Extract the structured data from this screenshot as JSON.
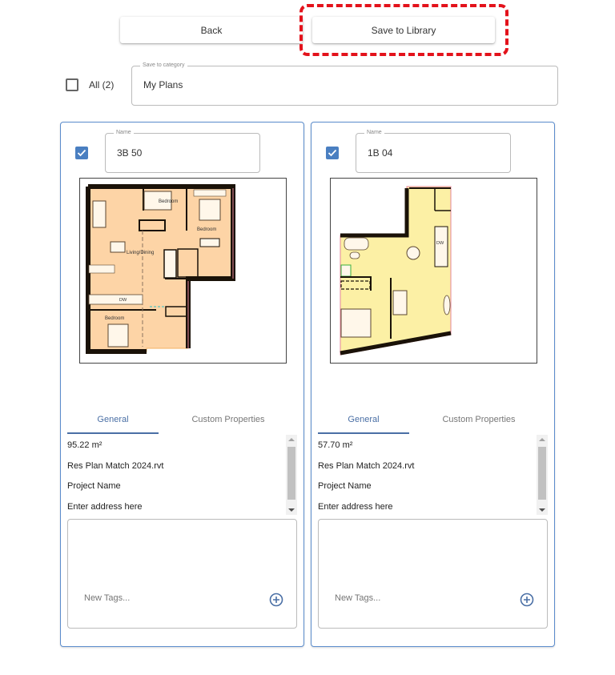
{
  "toolbar": {
    "back_label": "Back",
    "save_label": "Save to Library",
    "highlight_color": "#e3121b"
  },
  "selection": {
    "all_label": "All (2)",
    "all_checked": false
  },
  "category": {
    "legend": "Save to category",
    "value": "My Plans"
  },
  "tabs": {
    "general": "General",
    "custom": "Custom Properties"
  },
  "accent_color": "#4a6fa5",
  "cards": [
    {
      "checked": true,
      "name_legend": "Name",
      "name": "3B 50",
      "plan_fill": "#fdd4a6",
      "plan_labels": [
        "Bedroom",
        "Bedroom",
        "Living/Dining",
        "Bedroom",
        "DW"
      ],
      "properties": [
        "95.22 m²",
        "Res Plan Match 2024.rvt",
        "Project Name",
        "Enter address here"
      ],
      "tags_placeholder": "New Tags..."
    },
    {
      "checked": true,
      "name_legend": "Name",
      "name": "1B 04",
      "plan_fill": "#fcf0a5",
      "plan_labels": [
        "DW"
      ],
      "properties": [
        "57.70 m²",
        "Res Plan Match 2024.rvt",
        "Project Name",
        "Enter address here"
      ],
      "tags_placeholder": "New Tags..."
    }
  ]
}
